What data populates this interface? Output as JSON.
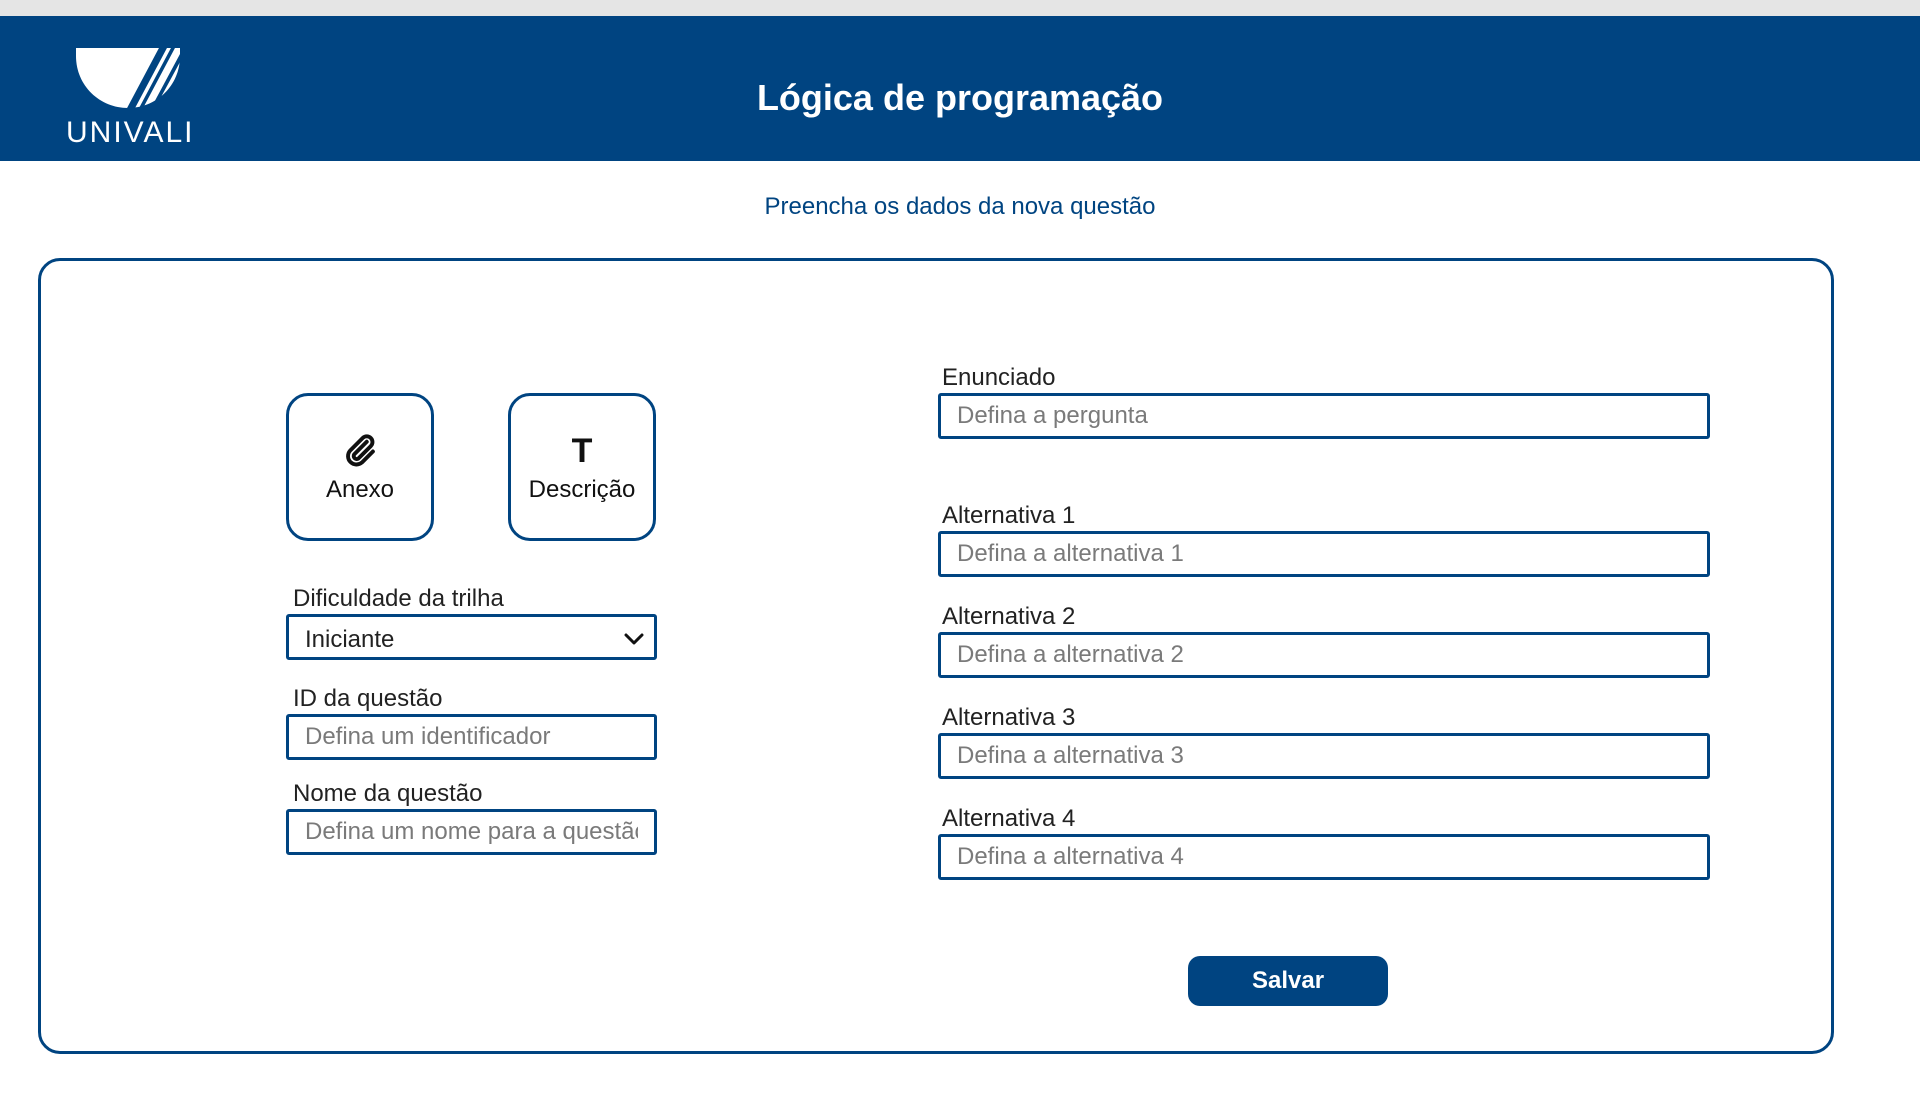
{
  "header": {
    "logo_text": "UNIVALI",
    "title": "Lógica de programação"
  },
  "subtitle": "Preencha os dados da nova questão",
  "tools": [
    {
      "icon": "paperclip-icon",
      "label": "Anexo"
    },
    {
      "icon": "text-t-icon",
      "label": "Descrição",
      "glyph": "T"
    }
  ],
  "left_form": {
    "difficulty": {
      "label": "Dificuldade da trilha",
      "value": "Iniciante"
    },
    "question_id": {
      "label": "ID da questão",
      "placeholder": "Defina um identificador"
    },
    "question_name": {
      "label": "Nome da questão",
      "placeholder": "Defina um nome para a questão"
    }
  },
  "right_form": {
    "statement": {
      "label": "Enunciado",
      "placeholder": "Defina a pergunta"
    },
    "alternatives": [
      {
        "label": "Alternativa 1",
        "placeholder": "Defina a alternativa 1"
      },
      {
        "label": "Alternativa 2",
        "placeholder": "Defina a alternativa 2"
      },
      {
        "label": "Alternativa 3",
        "placeholder": "Defina a alternativa 3"
      },
      {
        "label": "Alternativa 4",
        "placeholder": "Defina a alternativa 4"
      }
    ]
  },
  "actions": {
    "save_label": "Salvar"
  },
  "colors": {
    "brand": "#004481",
    "top_strip": "#e5e5e5"
  }
}
